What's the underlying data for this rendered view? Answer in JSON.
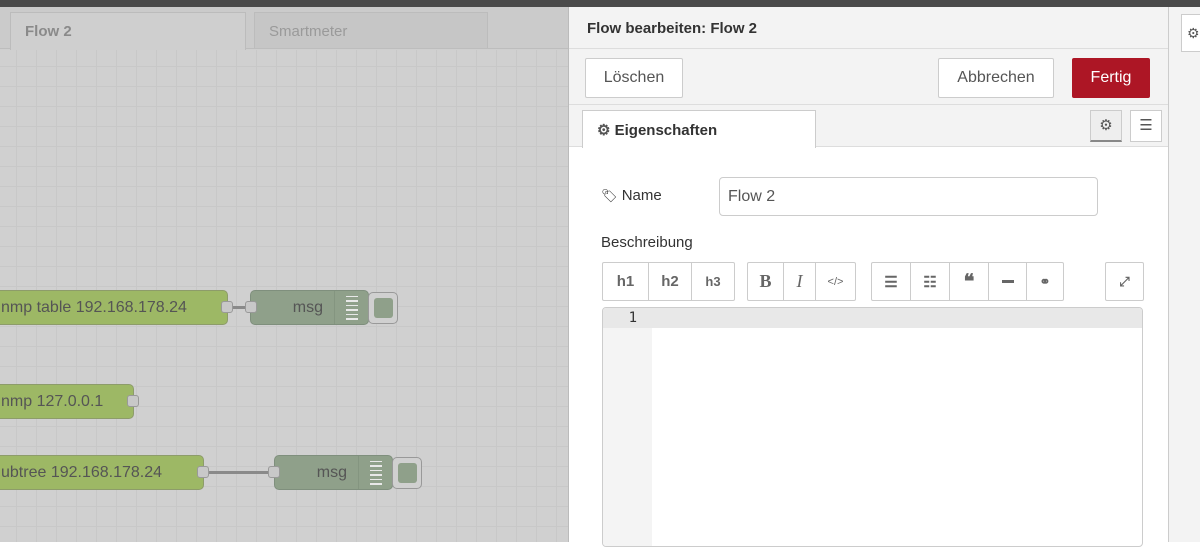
{
  "workspace": {
    "tabs": [
      {
        "label": "Flow 2",
        "active": true
      },
      {
        "label": "Smartmeter",
        "active": false
      }
    ],
    "nodes": [
      {
        "label": "nmp table 192.168.178.24"
      },
      {
        "label": "nmp 127.0.0.1"
      },
      {
        "label": "ubtree 192.168.178.24"
      }
    ],
    "debug_nodes": [
      {
        "label": "msg"
      },
      {
        "label": "msg"
      }
    ]
  },
  "panel": {
    "title": "Flow bearbeiten: Flow 2",
    "delete_label": "Löschen",
    "cancel_label": "Abbrechen",
    "done_label": "Fertig",
    "done_color": "#ad1625",
    "tab_label": "Eigenschaften",
    "name_label": "Name",
    "name_value": "Flow 2",
    "description_label": "Beschreibung",
    "toolbar": {
      "h1": "h1",
      "h2": "h2",
      "h3": "h3",
      "bold": "B",
      "italic": "I",
      "code": "</>"
    },
    "editor": {
      "line_number": "1"
    }
  },
  "right_tab": {
    "icon": "gear-icon"
  }
}
